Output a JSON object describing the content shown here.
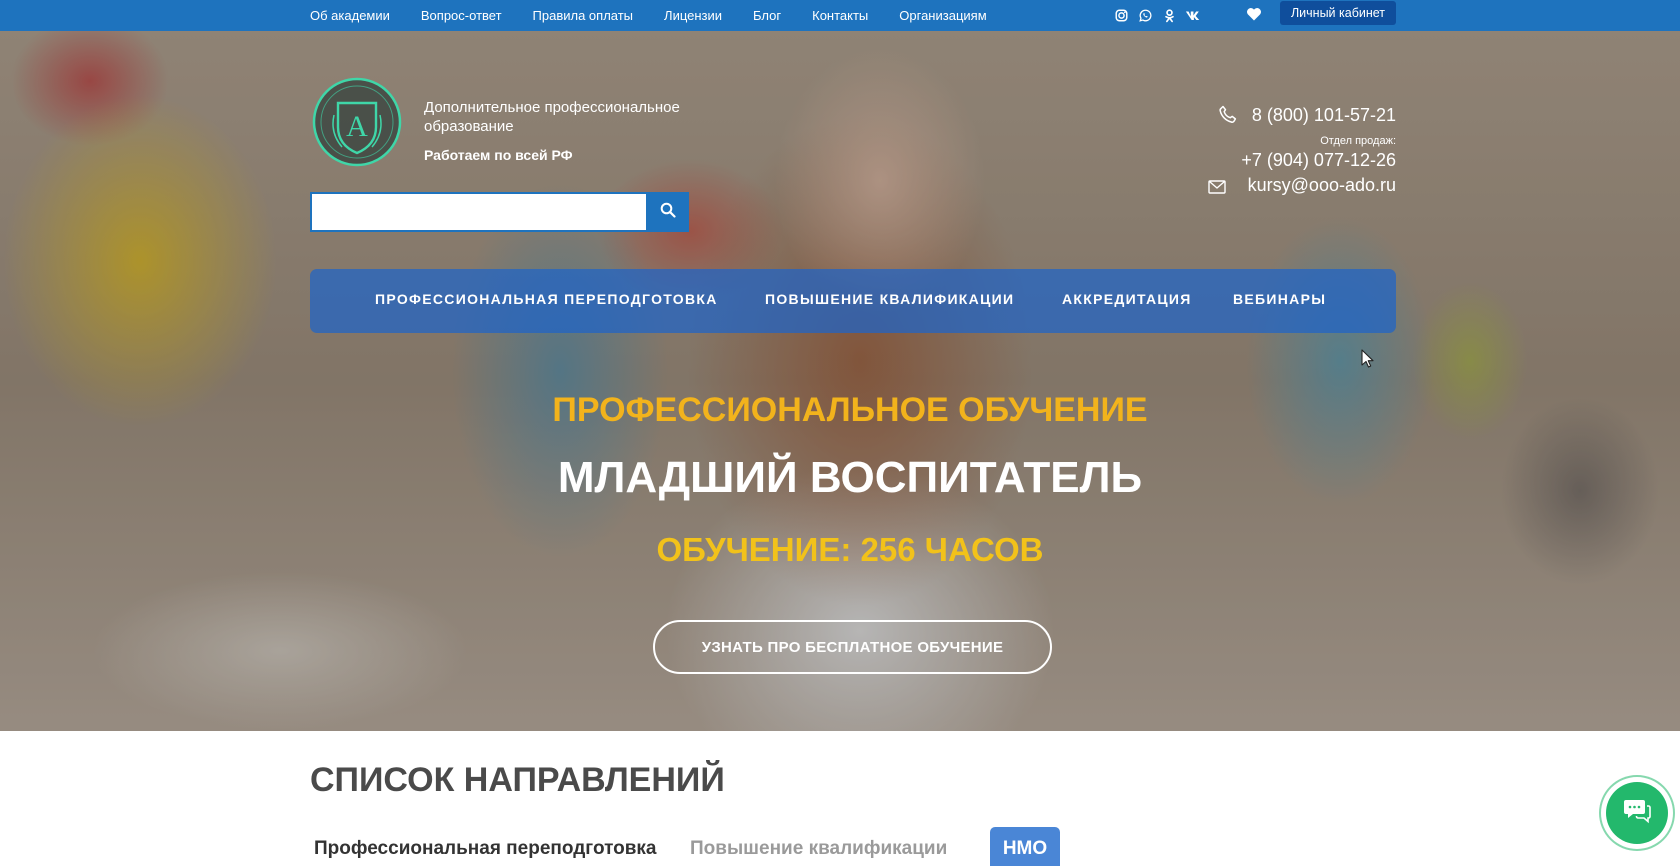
{
  "topbar": {
    "nav": [
      "Об академии",
      "Вопрос-ответ",
      "Правила оплаты",
      "Лицензии",
      "Блог",
      "Контакты",
      "Организациям"
    ],
    "socials": [
      "instagram-icon",
      "whatsapp-icon",
      "odnoklassniki-icon",
      "vk-icon"
    ],
    "cabinet_label": "Личный кабинет",
    "bar_color": "#1e73be"
  },
  "header": {
    "brand_line": "Дополнительное профессиональное образование",
    "brand_tagline": "Работаем по всей РФ",
    "phone_main": "8 (800) 101-57-21",
    "sales_label": "Отдел продаж:",
    "phone_sales": "+7 (904) 077-12-26",
    "email": "kursy@ooo-ado.ru",
    "search_placeholder": ""
  },
  "mainnav": {
    "items": [
      "ПРОФЕССИОНАЛЬНАЯ ПЕРЕПОДГОТОВКА",
      "ПОВЫШЕНИЕ КВАЛИФИКАЦИИ",
      "АККРЕДИТАЦИЯ",
      "ВЕБИНАРЫ"
    ]
  },
  "hero": {
    "subtitle": "ПРОФЕССИОНАЛЬНОЕ ОБУЧЕНИЕ",
    "title": "МЛАДШИЙ ВОСПИТАТЕЛЬ",
    "duration": "ОБУЧЕНИЕ: 256 ЧАСОВ",
    "cta": "УЗНАТЬ ПРО БЕСПЛАТНОЕ ОБУЧЕНИЕ",
    "accent_color": "#f2b31c"
  },
  "directions": {
    "title": "СПИСОК НАПРАВЛЕНИЙ",
    "tabs": [
      "Профессиональная переподготовка",
      "Повышение квалификации",
      "НМО"
    ],
    "active_tab": "НМО"
  }
}
